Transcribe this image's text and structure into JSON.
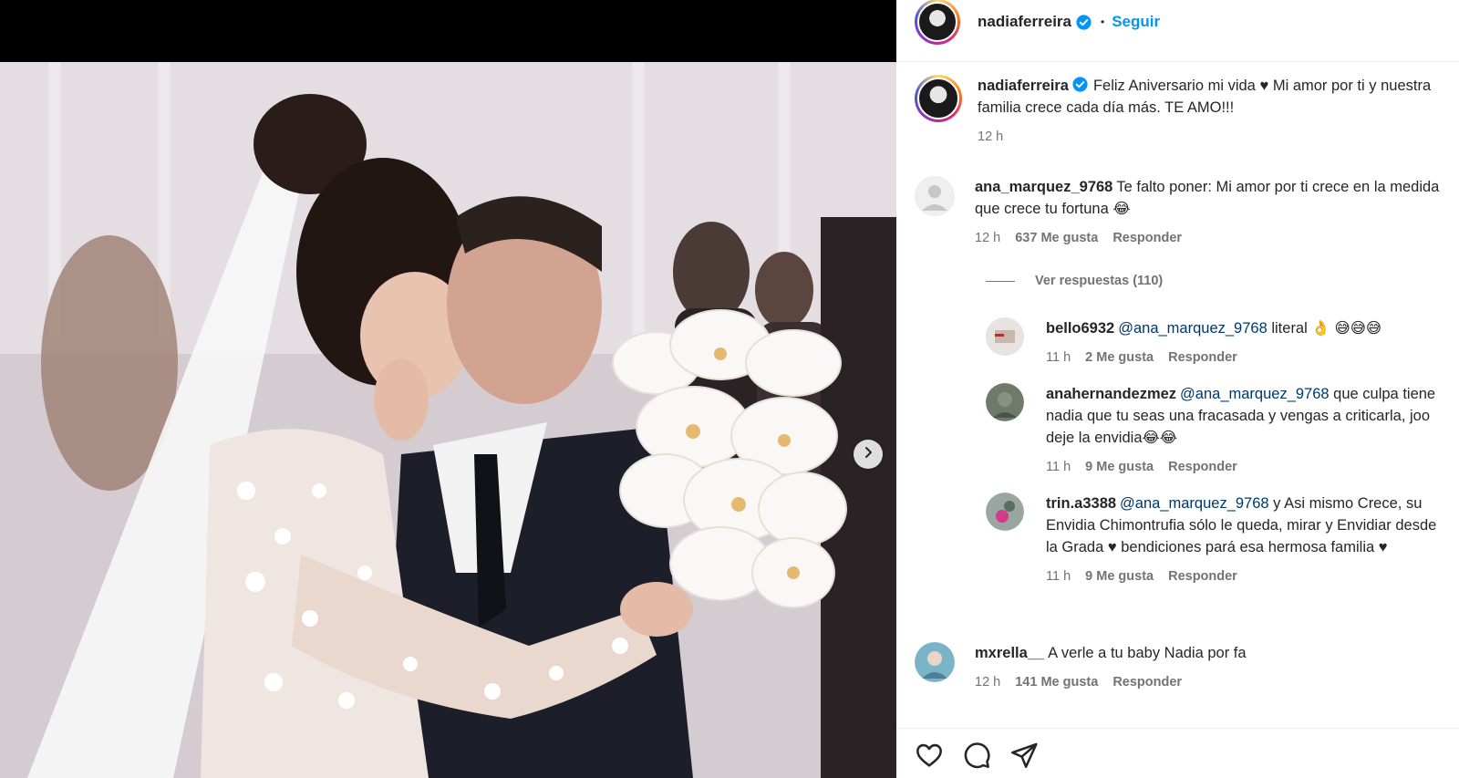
{
  "post": {
    "username": "nadiaferreira",
    "dot": "•",
    "follow_label": "Seguir",
    "caption": "Feliz Aniversario mi vida ♥ Mi amor por ti y nuestra familia crece cada día más. TE AMO!!!",
    "caption_time": "12 h"
  },
  "comments": [
    {
      "username": "ana_marquez_9768",
      "text": "Te falto poner: Mi amor por ti crece en la medida que crece tu fortuna 😂",
      "time": "12 h",
      "likes": "637 Me gusta",
      "reply_label": "Responder",
      "view_replies": "Ver respuestas (110)"
    },
    {
      "username": "mxrella__",
      "text": "A verle a tu baby Nadia por fa",
      "time": "12 h",
      "likes": "141 Me gusta",
      "reply_label": "Responder"
    }
  ],
  "replies": [
    {
      "username": "bello6932",
      "mention": "@ana_marquez_9768",
      "text": " literal 👌 😅😅😅",
      "time": "11 h",
      "likes": "2 Me gusta",
      "reply_label": "Responder"
    },
    {
      "username": "anahernandezmez",
      "mention": "@ana_marquez_9768",
      "text": " que culpa tiene nadia que tu seas una fracasada y vengas a criticarla, joo deje la envidia😂😂",
      "time": "11 h",
      "likes": "9 Me gusta",
      "reply_label": "Responder"
    },
    {
      "username": "trin.a3388",
      "mention": "@ana_marquez_9768",
      "text": " y Asi mismo Crece, su Envidia Chimontrufia sólo le queda, mirar y Envidiar desde la Grada ♥ bendiciones pará esa hermosa familia ♥",
      "time": "11 h",
      "likes": "9 Me gusta",
      "reply_label": "Responder"
    }
  ],
  "icons": {
    "like": "heart-icon",
    "comment": "comment-icon",
    "share": "share-icon",
    "next": "chevron-right-icon",
    "verified": "verified-badge-icon"
  },
  "colors": {
    "follow": "#0095f6",
    "verified": "#0095f6",
    "text": "#262626",
    "muted": "#737373",
    "mention": "#00376b"
  }
}
